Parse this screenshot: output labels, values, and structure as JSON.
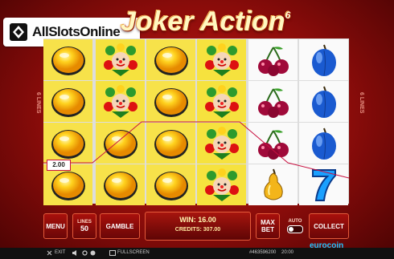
{
  "watermark": {
    "text": "AllSlotsOnline",
    "sub": "casino"
  },
  "title": {
    "text": "Joker Action",
    "sup": "6"
  },
  "side_left": "6 LINES",
  "side_right": "6 LINES",
  "reels": [
    {
      "bg": "yellow",
      "symbols": [
        "orange",
        "orange",
        "orange",
        "orange"
      ]
    },
    {
      "bg": "yellow",
      "symbols": [
        "joker",
        "joker",
        "orange",
        "orange"
      ]
    },
    {
      "bg": "yellow",
      "symbols": [
        "orange",
        "orange",
        "orange",
        "orange"
      ]
    },
    {
      "bg": "yellow",
      "symbols": [
        "joker",
        "joker",
        "joker",
        "joker"
      ]
    },
    {
      "bg": "white",
      "symbols": [
        "cherries",
        "cherries",
        "cherries",
        "pear"
      ]
    },
    {
      "bg": "white",
      "symbols": [
        "plum",
        "plum",
        "plum",
        "seven"
      ]
    }
  ],
  "win_line_value": "2.00",
  "buttons": {
    "menu": "MENU",
    "lines_label": "LINES",
    "lines_value": "50",
    "gamble": "GAMBLE",
    "max_bet_1": "MAX",
    "max_bet_2": "BET",
    "auto": "AUTO",
    "collect": "COLLECT"
  },
  "win": "WIN: 16.00",
  "credits": "CREDITS: 307.00",
  "brand": "eurocoin",
  "footer": {
    "exit": "EXIT",
    "fullscreen": "FULLSCREEN",
    "session": "#463596200",
    "time": "20:00"
  },
  "colors": {
    "accent": "#c81040",
    "panel": "#8a0c0a",
    "win_text": "#fff6b0"
  }
}
